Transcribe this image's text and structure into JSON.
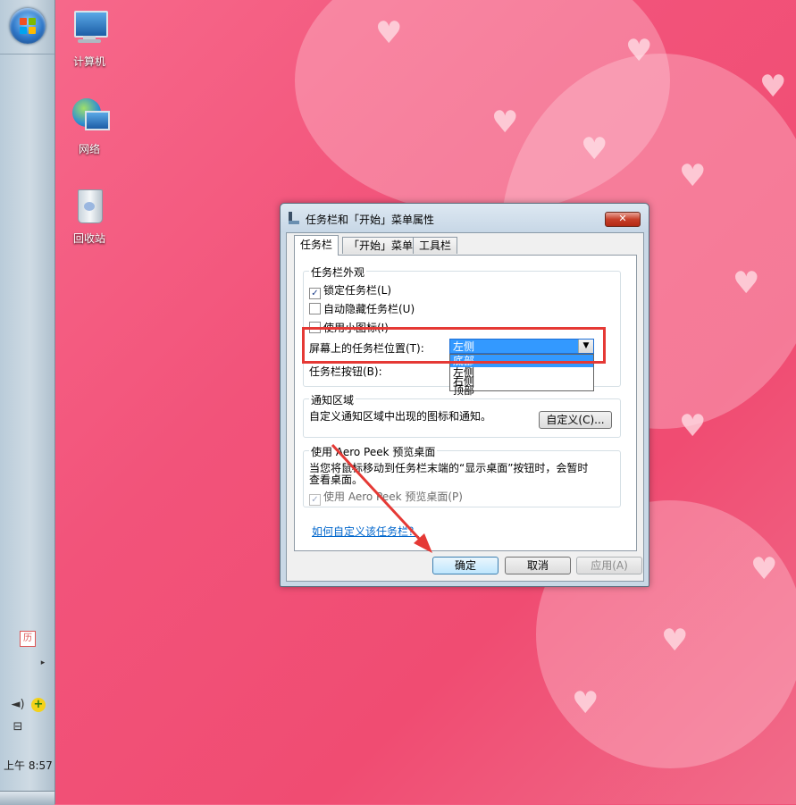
{
  "desktop": {
    "icons": [
      {
        "label": "计算机",
        "icon": "computer-icon"
      },
      {
        "label": "网络",
        "icon": "network-icon"
      },
      {
        "label": "回收站",
        "icon": "recycle-bin-icon"
      }
    ]
  },
  "taskbar": {
    "clock": "上午 8:57",
    "tray_icons": [
      "calendar-icon",
      "chevron-right-icon",
      "volume-icon",
      "add-icon",
      "network-icon"
    ]
  },
  "dialog": {
    "title": "任务栏和「开始」菜单属性",
    "close_label": "✕",
    "tabs": [
      {
        "label": "任务栏",
        "active": true
      },
      {
        "label": "「开始」菜单",
        "active": false
      },
      {
        "label": "工具栏",
        "active": false
      }
    ],
    "appearance": {
      "title": "任务栏外观",
      "lock_taskbar": {
        "label": "锁定任务栏(L)",
        "checked": true
      },
      "auto_hide": {
        "label": "自动隐藏任务栏(U)",
        "checked": false
      },
      "small_icons": {
        "label": "使用小图标(I)",
        "checked": false
      },
      "position_label": "屏幕上的任务栏位置(T):",
      "position_value": "左侧",
      "position_options": [
        "底部",
        "左侧",
        "右侧",
        "顶部"
      ],
      "buttons_label": "任务栏按钮(B):"
    },
    "notification": {
      "title": "通知区域",
      "text": "自定义通知区域中出现的图标和通知。",
      "customize_button": "自定义(C)..."
    },
    "aero_peek": {
      "title": "使用 Aero Peek 预览桌面",
      "text_line1": "当您将鼠标移动到任务栏末端的“显示桌面”按钮时，会暂时",
      "text_line2": "查看桌面。",
      "checkbox_label": "使用 Aero Peek 预览桌面(P)",
      "checked": true
    },
    "help_link": "如何自定义该任务栏？",
    "ok_button": "确定",
    "cancel_button": "取消",
    "apply_button": "应用(A)"
  },
  "colors": {
    "annotation": "#e53935",
    "selection": "#3399ff"
  }
}
